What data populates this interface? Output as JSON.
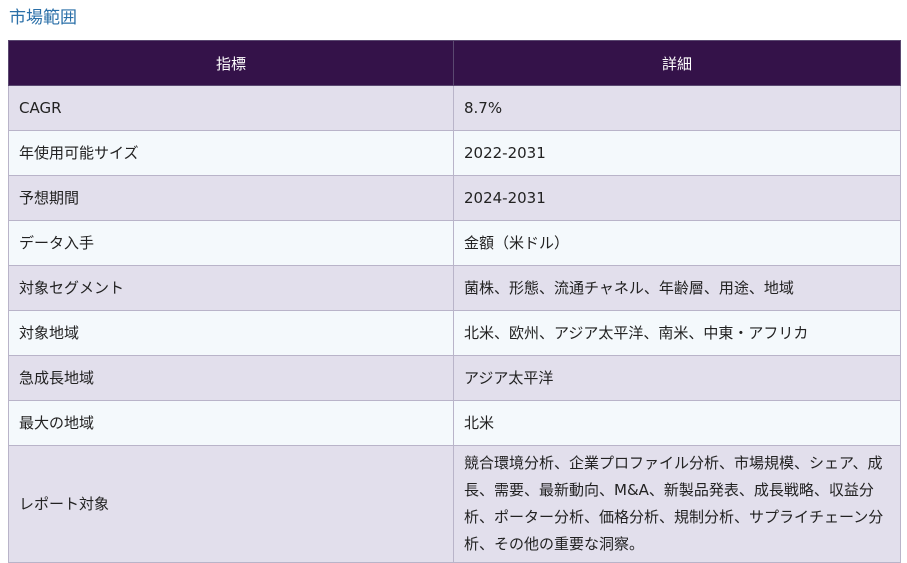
{
  "section": {
    "title": "市場範囲"
  },
  "table": {
    "headers": [
      "指標",
      "詳細"
    ],
    "rows": [
      [
        "CAGR",
        "8.7%"
      ],
      [
        "年使用可能サイズ",
        "2022-2031"
      ],
      [
        "予想期間",
        "2024-2031"
      ],
      [
        "データ入手",
        "金額（米ドル）"
      ],
      [
        "対象セグメント",
        "菌株、形態、流通チャネル、年齢層、用途、地域"
      ],
      [
        "対象地域",
        "北米、欧州、アジア太平洋、南米、中東・アフリカ"
      ],
      [
        "急成長地域",
        "アジア太平洋"
      ],
      [
        "最大の地域",
        "北米"
      ],
      [
        "レポート対象",
        "競合環境分析、企業プロファイル分析、市場規模、シェア、成長、需要、最新動向、M&A、新製品発表、成長戦略、収益分析、ポーター分析、価格分析、規制分析、サプライチェーン分析、その他の重要な洞察。"
      ]
    ]
  }
}
